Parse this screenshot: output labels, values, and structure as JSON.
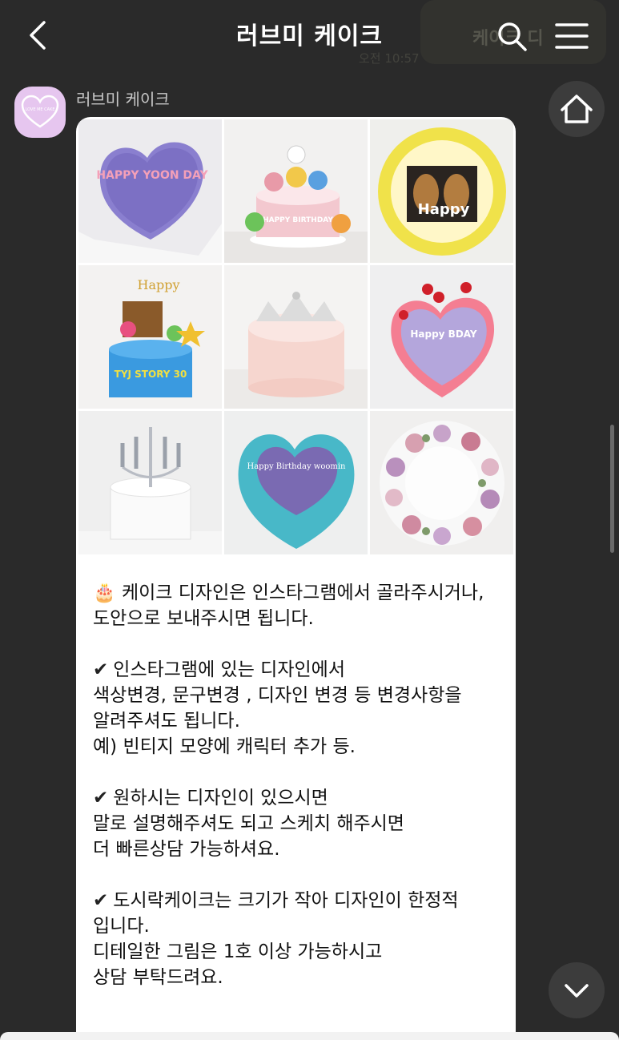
{
  "header": {
    "title": "러브미 케이크",
    "ghost_chip_text": "케이크 디",
    "ghost_sub_text": "오전 10:57"
  },
  "chat": {
    "sender_name": "러브미 케이크",
    "avatar_text": "LOVE ME CAKE",
    "images": [
      {
        "name": "purple-heart-cake",
        "caption": "HAPPY YOON DAY"
      },
      {
        "name": "pororo-character-cake",
        "caption": "HAPPY BIRTHDAY"
      },
      {
        "name": "dog-photo-cake",
        "caption": "Happy"
      },
      {
        "name": "toy-story-cake",
        "caption": "TYJ STORY 30"
      },
      {
        "name": "crown-cake",
        "caption": ""
      },
      {
        "name": "cherry-heart-cake",
        "caption": "Happy BDAY"
      },
      {
        "name": "candelabra-cake",
        "caption": ""
      },
      {
        "name": "blue-heart-cake",
        "caption": "Happy Birthday woomin"
      },
      {
        "name": "flower-wreath-cake",
        "caption": ""
      }
    ],
    "message": {
      "intro_emoji": "🎂",
      "intro": "케이크 디자인은 인스타그램에서 골라주시거나,\n도안으로 보내주시면 됩니다.",
      "check_mark": "✔",
      "point1": "인스타그램에 있는 디자인에서\n색상변경, 문구변경 , 디자인 변경 등 변경사항을\n알려주셔도 됩니다.\n예) 빈티지 모양에 캐릭터 추가 등.",
      "point2": "원하시는 디자인이 있으시면\n말로 설명해주셔도 되고 스케치 해주시면\n더 빠른상담 가능하셔요.",
      "point3": "도시락케이크는 크기가 작아 디자인이 한정적\n입니다.\n디테일한 그림은 1호 이상 가능하시고\n상담 부탁드려요."
    }
  },
  "colors": {
    "background": "#2a2a2a",
    "bubble": "#ffffff",
    "avatar": "#e6c6ef",
    "fab": "#3c3c3c"
  },
  "icons": [
    "back-arrow-icon",
    "search-icon",
    "hamburger-menu-icon",
    "home-icon",
    "chevron-down-icon",
    "heart-logo-icon"
  ]
}
